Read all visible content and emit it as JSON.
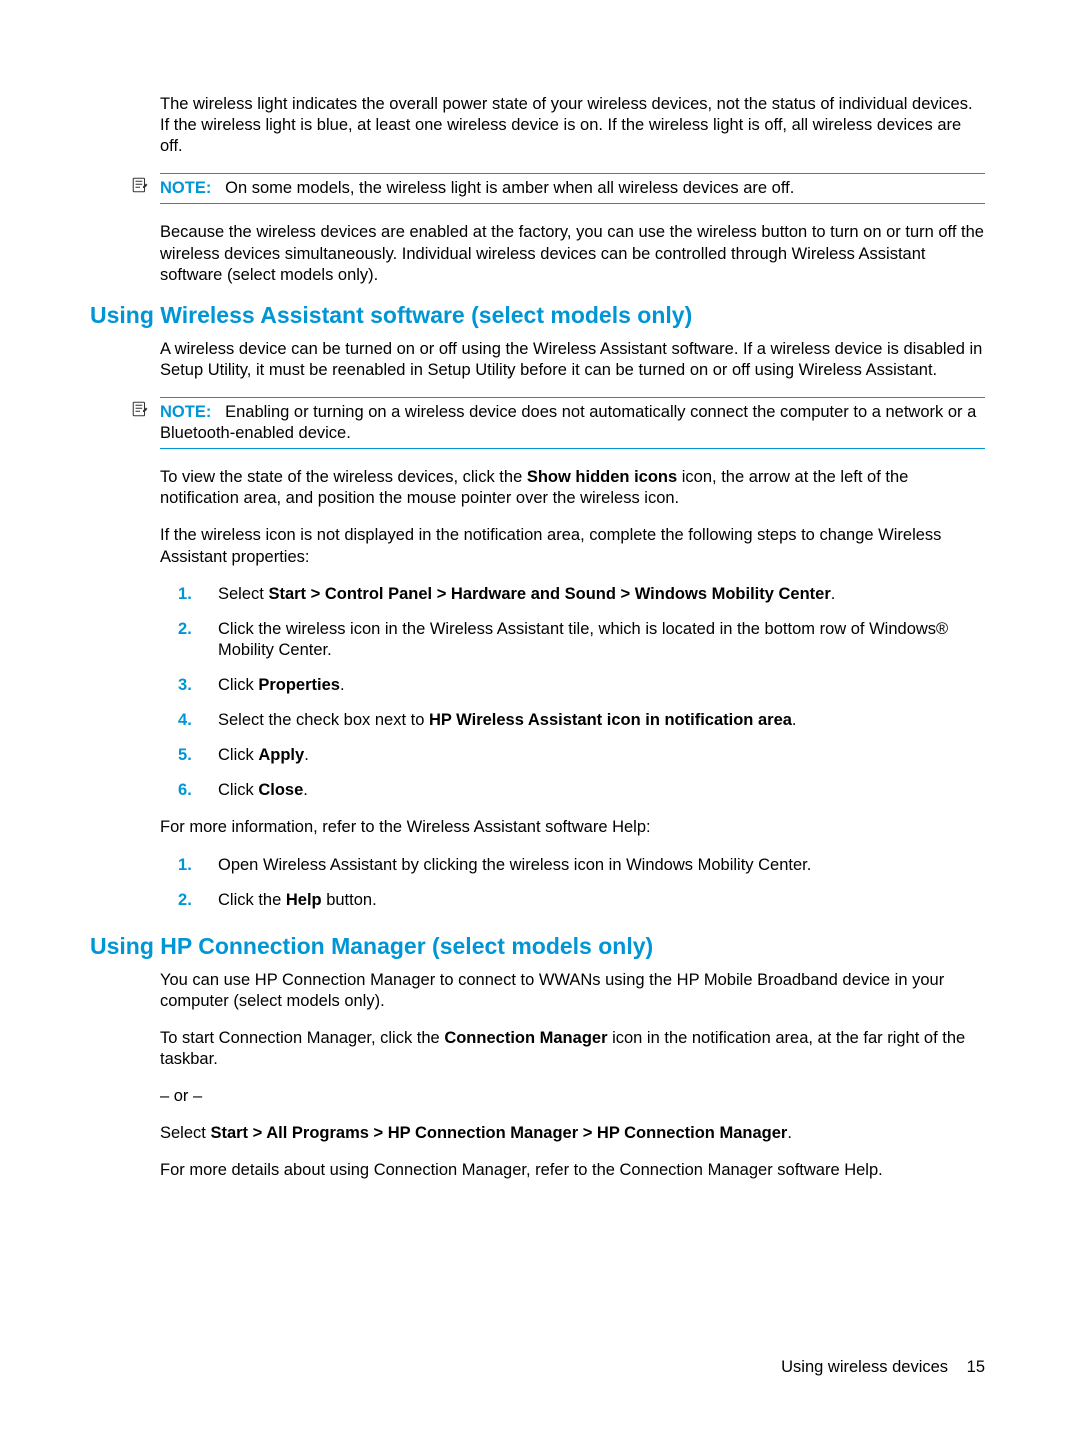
{
  "body": {
    "para1": "The wireless light indicates the overall power state of your wireless devices, not the status of individual devices. If the wireless light is blue, at least one wireless device is on. If the wireless light is off, all wireless devices are off.",
    "note1": {
      "label": "NOTE:",
      "text": "On some models, the wireless light is amber when all wireless devices are off."
    },
    "para2": "Because the wireless devices are enabled at the factory, you can use the wireless button to turn on or turn off the wireless devices simultaneously. Individual wireless devices can be controlled through Wireless Assistant software (select models only).",
    "headingA": "Using Wireless Assistant software (select models only)",
    "paraA1": "A wireless device can be turned on or off using the Wireless Assistant software. If a wireless device is disabled in Setup Utility, it must be reenabled in Setup Utility before it can be turned on or off using Wireless Assistant.",
    "note2": {
      "label": "NOTE:",
      "text": "Enabling or turning on a wireless device does not automatically connect the computer to a network or a Bluetooth-enabled device."
    },
    "paraA2_pre": "To view the state of the wireless devices, click the ",
    "paraA2_bold": "Show hidden icons",
    "paraA2_post": " icon, the arrow at the left of the notification area, and position the mouse pointer over the wireless icon.",
    "paraA3": "If the wireless icon is not displayed in the notification area, complete the following steps to change Wireless Assistant properties:",
    "listA": {
      "i1_pre": "Select ",
      "i1_bold": "Start > Control Panel > Hardware and Sound > Windows Mobility Center",
      "i1_post": ".",
      "i2": "Click the wireless icon in the Wireless Assistant tile, which is located in the bottom row of Windows® Mobility Center.",
      "i3_pre": "Click ",
      "i3_bold": "Properties",
      "i3_post": ".",
      "i4_pre": "Select the check box next to ",
      "i4_bold": "HP Wireless Assistant icon in notification area",
      "i4_post": ".",
      "i5_pre": "Click ",
      "i5_bold": "Apply",
      "i5_post": ".",
      "i6_pre": "Click ",
      "i6_bold": "Close",
      "i6_post": "."
    },
    "paraA4": "For more information, refer to the Wireless Assistant software Help:",
    "listB": {
      "i1": "Open Wireless Assistant by clicking the wireless icon in Windows Mobility Center.",
      "i2_pre": "Click the ",
      "i2_bold": "Help",
      "i2_post": " button."
    },
    "headingB": "Using HP Connection Manager (select models only)",
    "paraB1": "You can use HP Connection Manager to connect to WWANs using the HP Mobile Broadband device in your computer (select models only).",
    "paraB2_pre": "To start Connection Manager, click the ",
    "paraB2_bold": "Connection Manager",
    "paraB2_post": " icon in the notification area, at the far right of the taskbar.",
    "paraB3": "– or –",
    "paraB4_pre": "Select ",
    "paraB4_bold": "Start > All Programs > HP Connection Manager > HP Connection Manager",
    "paraB4_post": ".",
    "paraB5": "For more details about using Connection Manager, refer to the Connection Manager software Help."
  },
  "footer": {
    "text": "Using wireless devices",
    "page": "15"
  }
}
